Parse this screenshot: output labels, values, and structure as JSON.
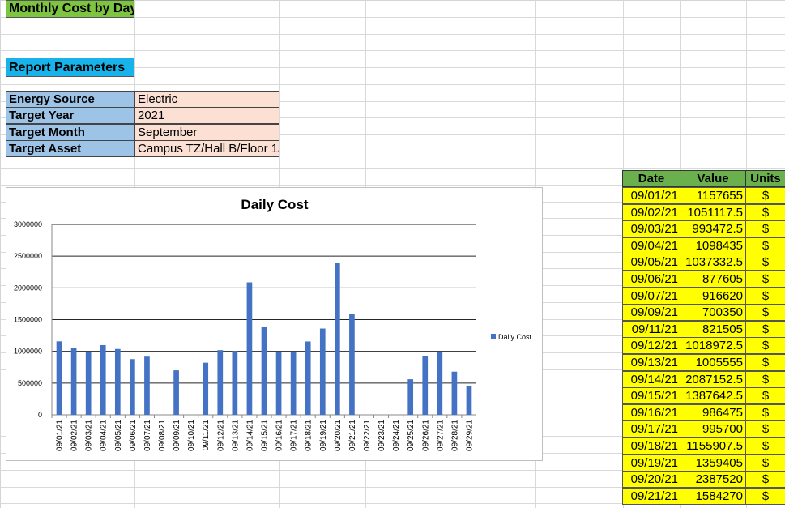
{
  "title": "Monthly Cost by Day",
  "report_parameters": "Report Parameters",
  "params": [
    {
      "label": "Energy Source",
      "value": "Electric"
    },
    {
      "label": "Target Year",
      "value": "2021"
    },
    {
      "label": "Target Month",
      "value": "September"
    },
    {
      "label": "Target Asset",
      "value": "Campus TZ/Hall B/Floor 1/"
    }
  ],
  "table": {
    "headers": [
      "Date",
      "Value",
      "Units"
    ],
    "rows": [
      [
        "09/01/21",
        "1157655",
        "$"
      ],
      [
        "09/02/21",
        "1051117.5",
        "$"
      ],
      [
        "09/03/21",
        "993472.5",
        "$"
      ],
      [
        "09/04/21",
        "1098435",
        "$"
      ],
      [
        "09/05/21",
        "1037332.5",
        "$"
      ],
      [
        "09/06/21",
        "877605",
        "$"
      ],
      [
        "09/07/21",
        "916620",
        "$"
      ],
      [
        "09/09/21",
        "700350",
        "$"
      ],
      [
        "09/11/21",
        "821505",
        "$"
      ],
      [
        "09/12/21",
        "1018972.5",
        "$"
      ],
      [
        "09/13/21",
        "1005555",
        "$"
      ],
      [
        "09/14/21",
        "2087152.5",
        "$"
      ],
      [
        "09/15/21",
        "1387642.5",
        "$"
      ],
      [
        "09/16/21",
        "986475",
        "$"
      ],
      [
        "09/17/21",
        "995700",
        "$"
      ],
      [
        "09/18/21",
        "1155907.5",
        "$"
      ],
      [
        "09/19/21",
        "1359405",
        "$"
      ],
      [
        "09/20/21",
        "2387520",
        "$"
      ],
      [
        "09/21/21",
        "1584270",
        "$"
      ]
    ]
  },
  "colors": {
    "title_bg": "#7dc441",
    "report_bg": "#17b3ea",
    "param_label_bg": "#9dc3e6",
    "param_value_bg": "#fbe0d3",
    "header_bg": "#6ab04c",
    "row_bg": "#ffff00",
    "bar": "#4472c4"
  },
  "chart_data": {
    "type": "bar",
    "title": "Daily Cost",
    "legend": "right",
    "series": [
      {
        "name": "Daily Cost",
        "values": [
          1157655,
          1051117.5,
          993472.5,
          1098435,
          1037332.5,
          877605,
          916620,
          null,
          700350,
          null,
          821505,
          1018972.5,
          1005555,
          2087152.5,
          1387642.5,
          986475,
          995700,
          1155907.5,
          1359405,
          2387520,
          1584270,
          null,
          null,
          null,
          560000,
          930000,
          990000,
          680000,
          450000
        ]
      }
    ],
    "categories": [
      "09/01/21",
      "09/02/21",
      "09/03/21",
      "09/04/21",
      "09/05/21",
      "09/06/21",
      "09/07/21",
      "09/08/21",
      "09/09/21",
      "09/10/21",
      "09/11/21",
      "09/12/21",
      "09/13/21",
      "09/14/21",
      "09/15/21",
      "09/16/21",
      "09/17/21",
      "09/18/21",
      "09/19/21",
      "09/20/21",
      "09/21/21",
      "09/22/21",
      "09/23/21",
      "09/24/21",
      "09/25/21",
      "09/26/21",
      "09/27/21",
      "09/28/21",
      "09/29/21"
    ],
    "yticks": [
      "0",
      "500000",
      "1000000",
      "1500000",
      "2000000",
      "2500000",
      "3000000"
    ],
    "ylim": [
      0,
      3000000
    ],
    "grid": true
  }
}
